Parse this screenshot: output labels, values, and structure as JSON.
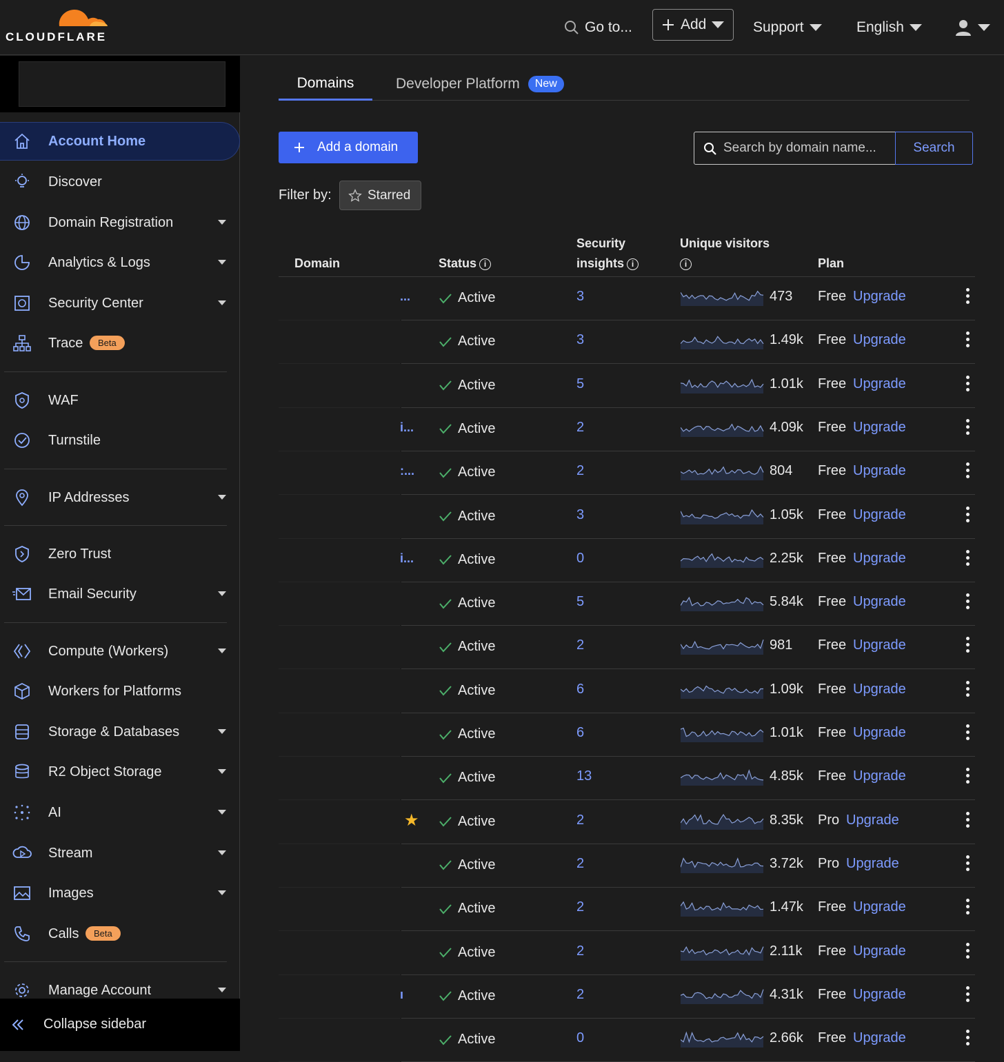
{
  "brand": {
    "name": "CLOUDFLARE",
    "accent": "#f48120"
  },
  "topbar": {
    "goto": "Go to...",
    "add": "Add",
    "support": "Support",
    "language": "English"
  },
  "sidebar": {
    "items": [
      {
        "label": "Account Home",
        "icon": "home-icon",
        "active": true
      },
      {
        "label": "Discover",
        "icon": "lightbulb-icon"
      },
      {
        "label": "Domain Registration",
        "icon": "globe-icon",
        "caret": true
      },
      {
        "label": "Analytics & Logs",
        "icon": "pie-chart-icon",
        "caret": true
      },
      {
        "label": "Security Center",
        "icon": "shield-grid-icon",
        "caret": true
      },
      {
        "label": "Trace",
        "icon": "network-icon",
        "badge": "Beta"
      },
      {
        "label": "WAF",
        "icon": "waf-shield-icon"
      },
      {
        "label": "Turnstile",
        "icon": "turnstile-icon"
      },
      {
        "label": "IP Addresses",
        "icon": "location-pin-icon",
        "caret": true
      },
      {
        "label": "Zero Trust",
        "icon": "zero-trust-icon"
      },
      {
        "label": "Email Security",
        "icon": "email-icon",
        "caret": true
      },
      {
        "label": "Compute (Workers)",
        "icon": "workers-icon",
        "caret": true
      },
      {
        "label": "Workers for Platforms",
        "icon": "cube-icon"
      },
      {
        "label": "Storage & Databases",
        "icon": "database-icon",
        "caret": true
      },
      {
        "label": "R2 Object Storage",
        "icon": "bucket-icon",
        "caret": true
      },
      {
        "label": "AI",
        "icon": "sparkle-icon",
        "caret": true
      },
      {
        "label": "Stream",
        "icon": "stream-icon",
        "caret": true
      },
      {
        "label": "Images",
        "icon": "image-icon",
        "caret": true
      },
      {
        "label": "Calls",
        "icon": "phone-icon",
        "badge": "Beta"
      },
      {
        "label": "Manage Account",
        "icon": "gear-icon",
        "caret": true
      }
    ],
    "collapse": "Collapse sidebar"
  },
  "tabs": {
    "domains": "Domains",
    "developer": "Developer Platform",
    "new_badge": "New"
  },
  "actions": {
    "add_domain": "Add a domain",
    "search_placeholder": "Search by domain name...",
    "search_button": "Search",
    "filter_label": "Filter by:",
    "starred": "Starred"
  },
  "table": {
    "headers": {
      "domain": "Domain",
      "status": "Status",
      "security_1": "Security",
      "security_2": "insights",
      "visitors": "Unique visitors",
      "plan": "Plan"
    },
    "rows": [
      {
        "dom": "...",
        "status": "Active",
        "sec": "3",
        "uv": "473",
        "plan": "Free",
        "up": "Upgrade"
      },
      {
        "dom": "",
        "status": "Active",
        "sec": "3",
        "uv": "1.49k",
        "plan": "Free",
        "up": "Upgrade"
      },
      {
        "dom": "",
        "status": "Active",
        "sec": "5",
        "uv": "1.01k",
        "plan": "Free",
        "up": "Upgrade"
      },
      {
        "dom": "i...",
        "status": "Active",
        "sec": "2",
        "uv": "4.09k",
        "plan": "Free",
        "up": "Upgrade"
      },
      {
        "dom": ":...",
        "status": "Active",
        "sec": "2",
        "uv": "804",
        "plan": "Free",
        "up": "Upgrade"
      },
      {
        "dom": "",
        "status": "Active",
        "sec": "3",
        "uv": "1.05k",
        "plan": "Free",
        "up": "Upgrade"
      },
      {
        "dom": "i...",
        "status": "Active",
        "sec": "0",
        "uv": "2.25k",
        "plan": "Free",
        "up": "Upgrade"
      },
      {
        "dom": "",
        "status": "Active",
        "sec": "5",
        "uv": "5.84k",
        "plan": "Free",
        "up": "Upgrade"
      },
      {
        "dom": "",
        "status": "Active",
        "sec": "2",
        "uv": "981",
        "plan": "Free",
        "up": "Upgrade"
      },
      {
        "dom": "",
        "status": "Active",
        "sec": "6",
        "uv": "1.09k",
        "plan": "Free",
        "up": "Upgrade"
      },
      {
        "dom": "",
        "status": "Active",
        "sec": "6",
        "uv": "1.01k",
        "plan": "Free",
        "up": "Upgrade"
      },
      {
        "dom": "",
        "status": "Active",
        "sec": "13",
        "uv": "4.85k",
        "plan": "Free",
        "up": "Upgrade"
      },
      {
        "dom": "",
        "status": "Active",
        "sec": "2",
        "uv": "8.35k",
        "plan": "Pro",
        "up": "Upgrade",
        "starred": true
      },
      {
        "dom": "",
        "status": "Active",
        "sec": "2",
        "uv": "3.72k",
        "plan": "Pro",
        "up": "Upgrade"
      },
      {
        "dom": "",
        "status": "Active",
        "sec": "2",
        "uv": "1.47k",
        "plan": "Free",
        "up": "Upgrade"
      },
      {
        "dom": "",
        "status": "Active",
        "sec": "2",
        "uv": "2.11k",
        "plan": "Free",
        "up": "Upgrade"
      },
      {
        "dom": "ı",
        "status": "Active",
        "sec": "2",
        "uv": "4.31k",
        "plan": "Free",
        "up": "Upgrade"
      },
      {
        "dom": "",
        "status": "Active",
        "sec": "0",
        "uv": "2.66k",
        "plan": "Free",
        "up": "Upgrade"
      }
    ]
  }
}
